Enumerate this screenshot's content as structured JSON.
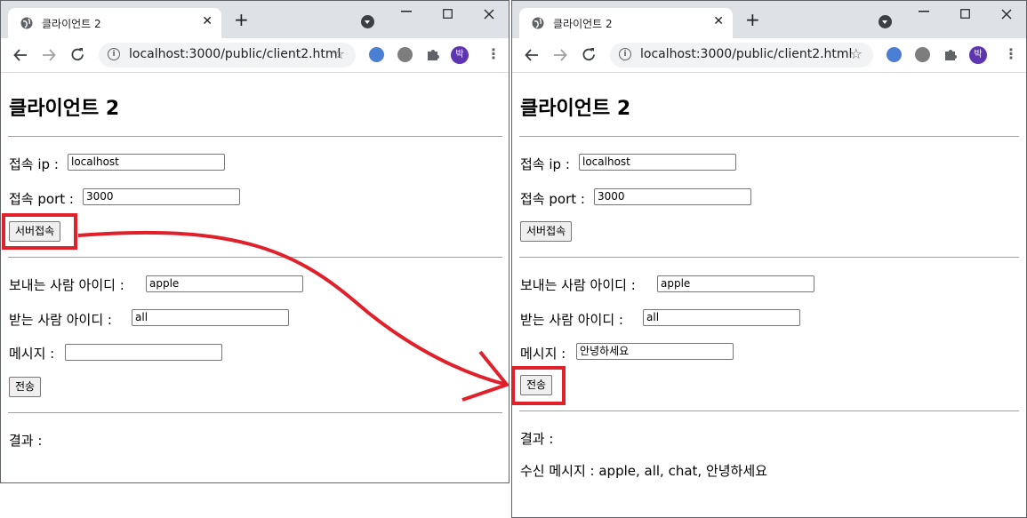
{
  "browser": {
    "tab_title": "클라이언트 2",
    "close_glyph": "✕",
    "newtab_glyph": "+",
    "url": "localhost:3000/public/client2.html",
    "avatar_letter": "박"
  },
  "page": {
    "heading": "클라이언트 2",
    "ip_label": "접속 ip :",
    "port_label": "접속 port :",
    "connect_button": "서버접속",
    "sender_label": "보내는 사람 아이디 :",
    "receiver_label": "받는 사람 아이디 :",
    "message_label": "메시지 :",
    "send_button": "전송",
    "result_label": "결과 :"
  },
  "left": {
    "ip_value": "localhost",
    "port_value": "3000",
    "sender_value": "apple",
    "receiver_value": "all",
    "message_value": ""
  },
  "right": {
    "ip_value": "localhost",
    "port_value": "3000",
    "sender_value": "apple",
    "receiver_value": "all",
    "message_value": "안녕하세요",
    "received_text": "수신 메시지 : apple, all, chat, 안녕하세요"
  },
  "annotation": {
    "highlight_color": "#e0202a"
  }
}
